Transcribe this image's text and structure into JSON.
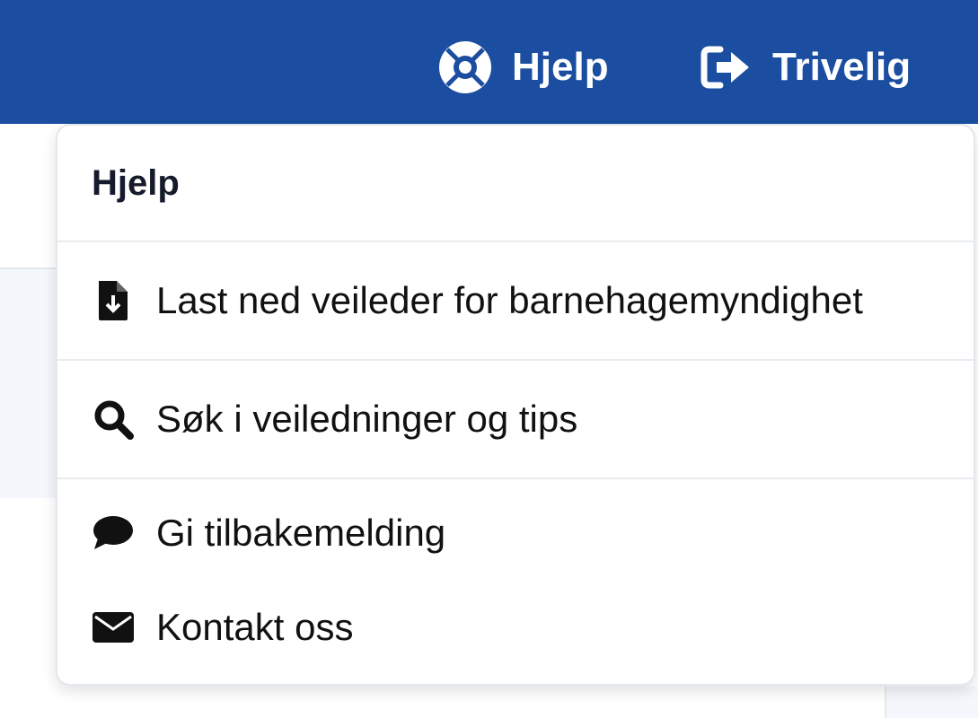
{
  "topbar": {
    "help_label": "Hjelp",
    "help_icon": "lifebuoy-icon",
    "logout_label": "Trivelig",
    "logout_icon": "sign-out-icon",
    "background_color": "#1b4ea0"
  },
  "help_menu": {
    "title": "Hjelp",
    "items": [
      {
        "label": "Last ned veileder for barnehagemyndighet",
        "icon": "file-download-icon"
      },
      {
        "label": "Søk i veiledninger og tips",
        "icon": "search-icon"
      },
      {
        "label": "Gi tilbakemelding",
        "icon": "comment-icon"
      },
      {
        "label": "Kontakt oss",
        "icon": "envelope-icon"
      }
    ]
  }
}
